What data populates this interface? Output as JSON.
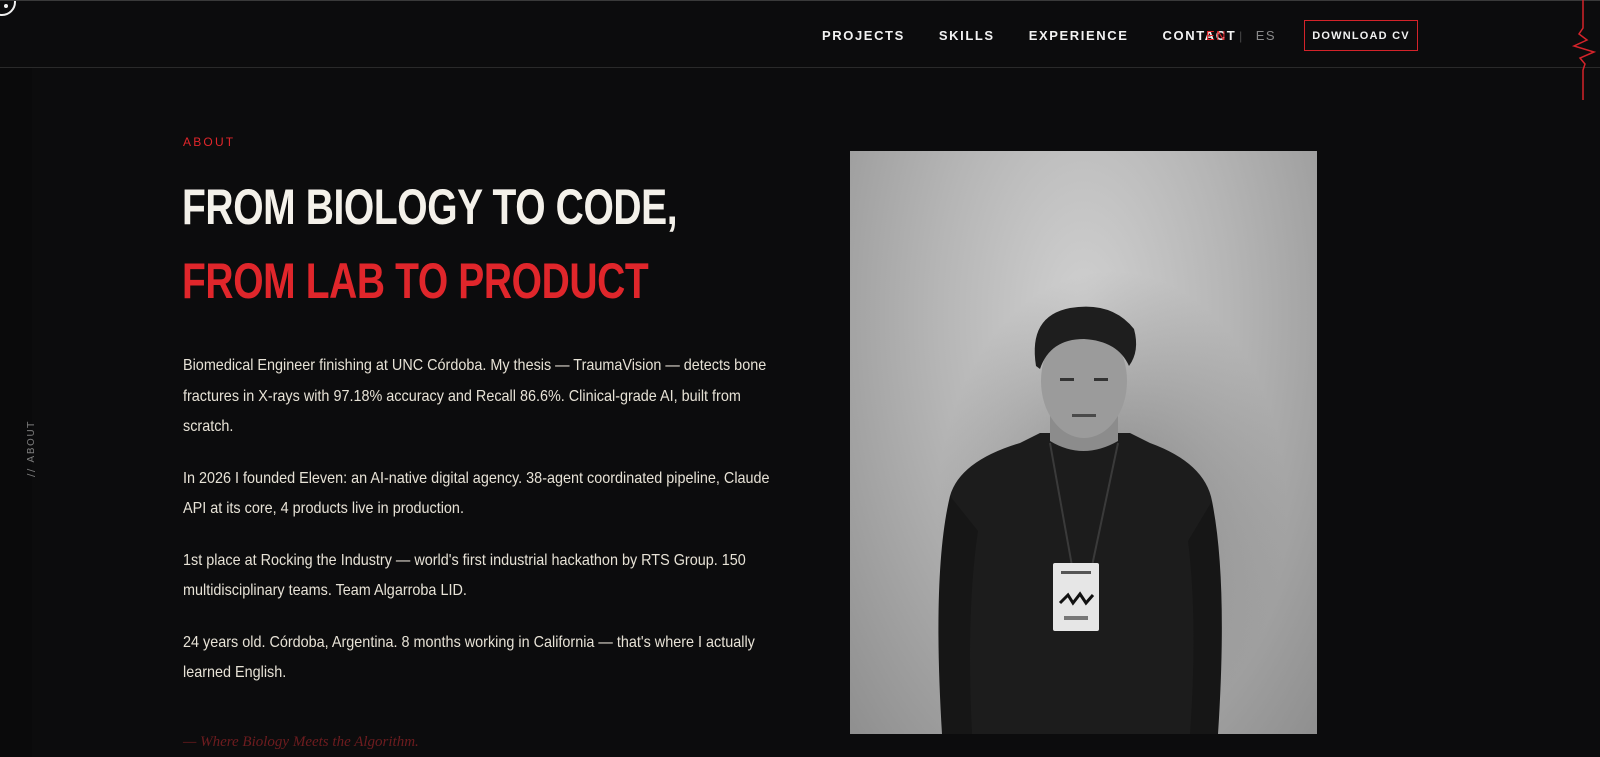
{
  "nav": {
    "items": [
      "PROJECTS",
      "SKILLS",
      "EXPERIENCE",
      "CONTACT"
    ],
    "lang_en": "EN",
    "lang_sep": "|",
    "lang_es": "ES",
    "cv_button": "DOWNLOAD CV"
  },
  "rail": {
    "label": "// ABOUT"
  },
  "about": {
    "eyebrow": "ABOUT",
    "headline_line1": "FROM BIOLOGY TO CODE,",
    "headline_line2": "FROM LAB TO PRODUCT",
    "paragraphs": [
      "Biomedical Engineer finishing at UNC Córdoba. My thesis — TraumaVision — detects bone fractures in X-rays with 97.18% accuracy and Recall 86.6%. Clinical-grade AI, built from scratch.",
      "In 2026 I founded Eleven: an AI-native digital agency. 38-agent coordinated pipeline, Claude API at its core, 4 products live in production.",
      "1st place at Rocking the Industry — world's first industrial hackathon by RTS Group. 150 multidisciplinary teams. Team Algarroba LID.",
      "24 years old. Córdoba, Argentina. 8 months working in California — that's where I actually learned English."
    ],
    "tagline": "— Where Biology Meets the Algorithm."
  },
  "colors": {
    "background": "#0c0c0d",
    "accent": "#e0262b",
    "text": "#e7e2d6"
  }
}
